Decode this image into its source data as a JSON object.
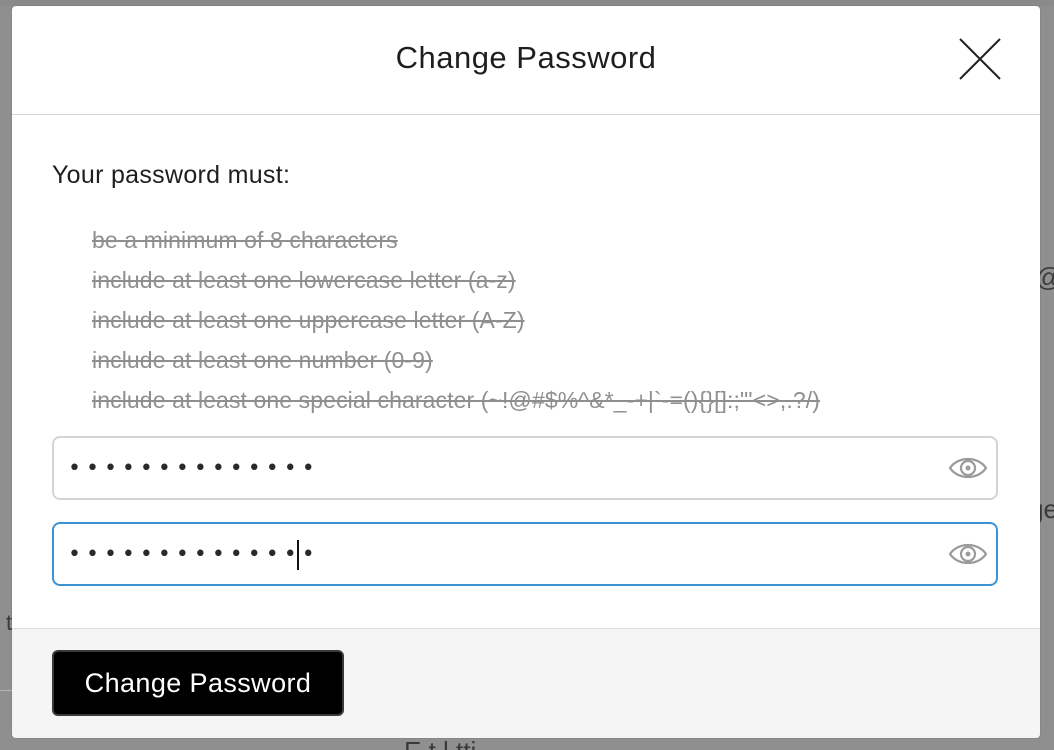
{
  "background": {
    "fragment_right_top": "@",
    "fragment_right_mid": "ge",
    "fragment_left": "t",
    "fragment_bottom": "E    t    l    tti"
  },
  "modal": {
    "title": "Change Password",
    "close_icon": "close-icon",
    "intro": "Your password must:",
    "rules": [
      "be a minimum of 8 characters",
      "include at least one lowercase letter (a-z)",
      "include at least one uppercase letter (A-Z)",
      "include at least one number (0-9)",
      "include at least one special character (~!@#$%^&*_-+|`-=(){}[]:;\"'<>,.?/)"
    ],
    "password_field": {
      "value": "••••••••••••••",
      "icon": "eye-icon"
    },
    "confirm_field": {
      "value": "••••••••••••••",
      "icon": "eye-icon"
    },
    "submit_label": "Change Password"
  },
  "colors": {
    "focus_border": "#3b93d3",
    "button_bg": "#000000",
    "rule_text": "#8f8f8f"
  }
}
